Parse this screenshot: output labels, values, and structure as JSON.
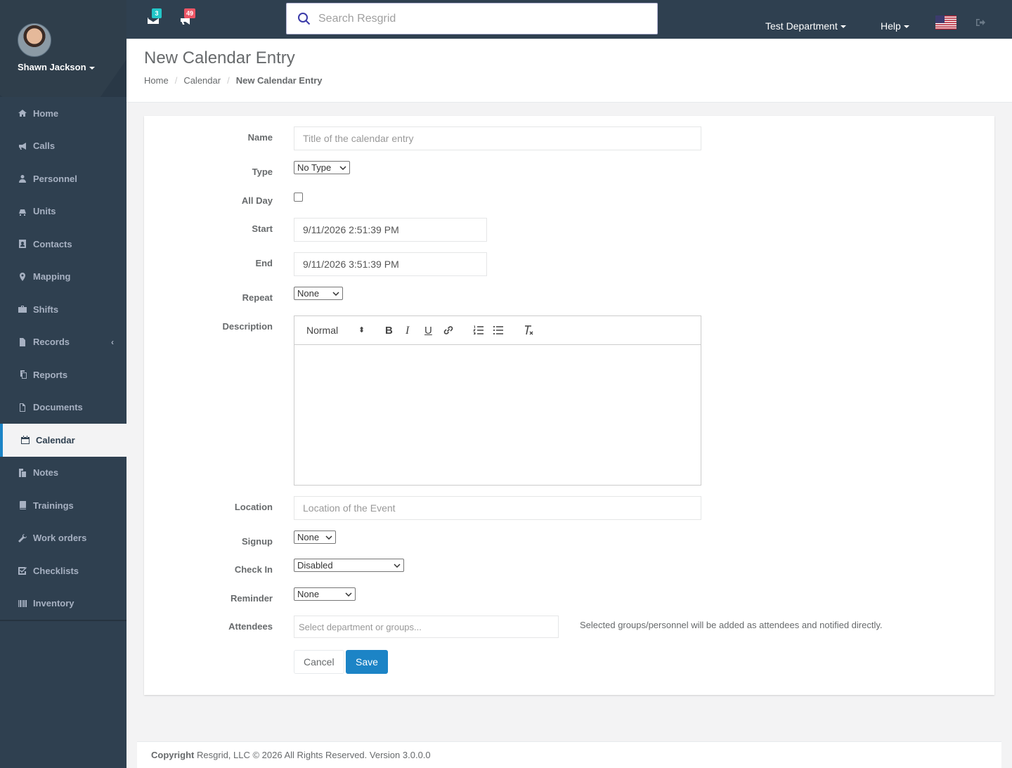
{
  "user": {
    "name": "Shawn Jackson"
  },
  "nav": {
    "items": [
      {
        "label": "Home",
        "icon": "home-icon"
      },
      {
        "label": "Calls",
        "icon": "bullhorn-icon"
      },
      {
        "label": "Personnel",
        "icon": "user-icon"
      },
      {
        "label": "Units",
        "icon": "truck-icon"
      },
      {
        "label": "Contacts",
        "icon": "address-book-icon"
      },
      {
        "label": "Mapping",
        "icon": "map-marker-icon"
      },
      {
        "label": "Shifts",
        "icon": "briefcase-icon"
      },
      {
        "label": "Records",
        "icon": "file-icon"
      },
      {
        "label": "Reports",
        "icon": "copy-icon"
      },
      {
        "label": "Documents",
        "icon": "file-text-icon"
      },
      {
        "label": "Calendar",
        "icon": "calendar-icon"
      },
      {
        "label": "Notes",
        "icon": "files-icon"
      },
      {
        "label": "Trainings",
        "icon": "book-icon"
      },
      {
        "label": "Work orders",
        "icon": "wrench-icon"
      },
      {
        "label": "Checklists",
        "icon": "check-square-icon"
      },
      {
        "label": "Inventory",
        "icon": "barcode-icon"
      }
    ],
    "active": "Calendar"
  },
  "topbar": {
    "messages_count": "3",
    "calls_count": "49",
    "search_placeholder": "Search Resgrid",
    "department": "Test Department",
    "help": "Help"
  },
  "heading": {
    "title": "New Calendar Entry",
    "breadcrumb": [
      "Home",
      "Calendar",
      "New Calendar Entry"
    ]
  },
  "form": {
    "name_label": "Name",
    "name_placeholder": "Title of the calendar entry",
    "type_label": "Type",
    "type_value": "No Type",
    "allday_label": "All Day",
    "start_label": "Start",
    "start_value": "9/11/2026 2:51:39 PM",
    "end_label": "End",
    "end_value": "9/11/2026 3:51:39 PM",
    "repeat_label": "Repeat",
    "repeat_value": "None",
    "description_label": "Description",
    "editor_format": "Normal",
    "location_label": "Location",
    "location_placeholder": "Location of the Event",
    "signup_label": "Signup",
    "signup_value": "None",
    "checkin_label": "Check In",
    "checkin_value": "Disabled",
    "reminder_label": "Reminder",
    "reminder_value": "None",
    "attendees_label": "Attendees",
    "attendees_placeholder": "Select department or groups...",
    "attendees_help": "Selected groups/personnel will be added as attendees and notified directly.",
    "cancel_label": "Cancel",
    "save_label": "Save"
  },
  "footer": {
    "copyright_label": "Copyright",
    "copyright_text": "Resgrid, LLC © 2026 All Rights Reserved.",
    "version": "Version 3.0.0.0"
  },
  "colors": {
    "sidebar": "#2f4050",
    "accent": "#1c84c6",
    "badge_teal": "#23c6c8",
    "badge_red": "#ed5565"
  }
}
